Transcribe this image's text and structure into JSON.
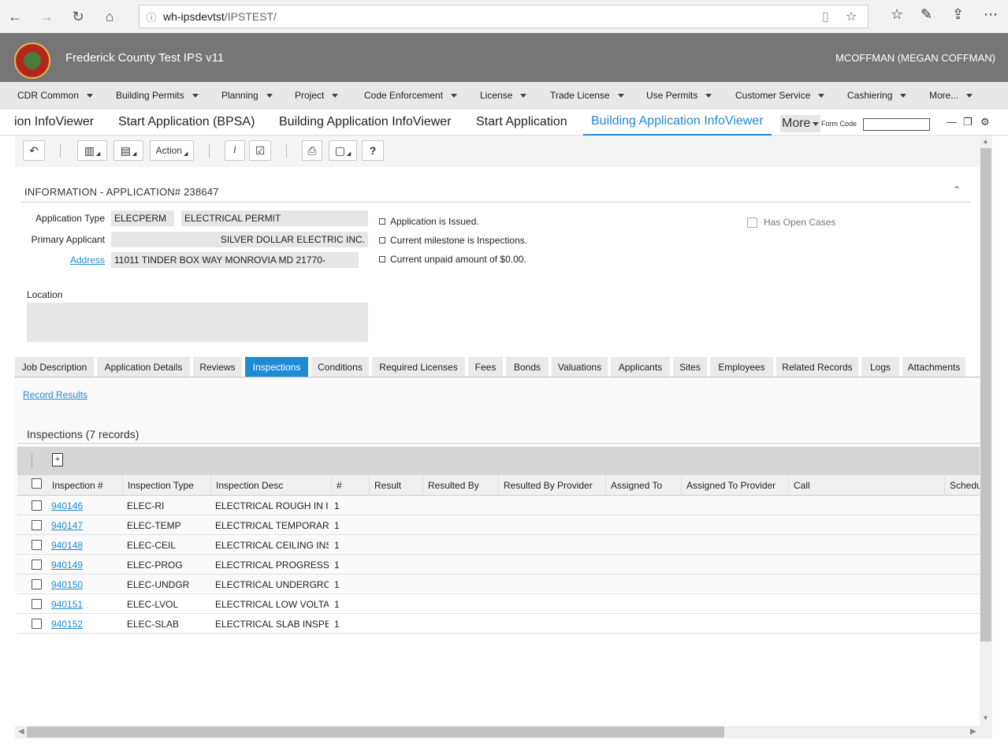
{
  "browser": {
    "back_icon": "back-arrow-icon",
    "url_host": "wh-ipsdevtst",
    "url_path": "/IPSTEST/"
  },
  "app": {
    "title": "Frederick County Test IPS v11",
    "user": "MCOFFMAN (MEGAN COFFMAN)"
  },
  "menu": [
    "CDR Common",
    "Building Permits",
    "Planning",
    "Project",
    "Code Enforcement",
    "License",
    "Trade License",
    "Use Permits",
    "Customer Service",
    "Cashiering",
    "More..."
  ],
  "workspace_tabs": [
    "ion InfoViewer",
    "Start Application (BPSA)",
    "Building Application InfoViewer",
    "Start Application",
    "Building Application InfoViewer"
  ],
  "workspace_more": "More",
  "form_code_label": "Form Code",
  "toolbar": {
    "action_label": "Action"
  },
  "section": {
    "title": "INFORMATION - APPLICATION# 238647"
  },
  "info": {
    "application_type_label": "Application Type",
    "application_type_code": "ELECPERM",
    "application_type_desc": "ELECTRICAL PERMIT",
    "primary_applicant_label": "Primary Applicant",
    "primary_applicant": "SILVER DOLLAR ELECTRIC INC.",
    "address_label": "Address",
    "address": "11011 TINDER BOX WAY MONROVIA MD 21770-",
    "location_label": "Location",
    "status_items": [
      "Application is Issued.",
      "Current milestone is Inspections.",
      "Current unpaid amount of $0.00."
    ],
    "has_open_cases_label": "Has Open Cases"
  },
  "detail_tabs": [
    "Job Description",
    "Application Details",
    "Reviews",
    "Inspections",
    "Conditions",
    "Required Licenses",
    "Fees",
    "Bonds",
    "Valuations",
    "Applicants",
    "Sites",
    "Employees",
    "Related Records",
    "Logs",
    "Attachments"
  ],
  "active_detail_tab": "Inspections",
  "inspections": {
    "record_results_link": "Record Results",
    "grid_title": "Inspections (7 records)",
    "columns": [
      "Inspection #",
      "Inspection Type",
      "Inspection Desc",
      "#",
      "Result",
      "Resulted By",
      "Resulted By Provider",
      "Assigned To",
      "Assigned To Provider",
      "Call",
      "Schedu"
    ],
    "rows": [
      {
        "number": "940146",
        "type": "ELEC-RI",
        "desc": "ELECTRICAL ROUGH IN I",
        "count": "1"
      },
      {
        "number": "940147",
        "type": "ELEC-TEMP",
        "desc": "ELECTRICAL TEMPORAR",
        "count": "1"
      },
      {
        "number": "940148",
        "type": "ELEC-CEIL",
        "desc": "ELECTRICAL CEILING INS",
        "count": "1"
      },
      {
        "number": "940149",
        "type": "ELEC-PROG",
        "desc": "ELECTRICAL PROGRESS",
        "count": "1"
      },
      {
        "number": "940150",
        "type": "ELEC-UNDGR",
        "desc": "ELECTRICAL UNDERGRC",
        "count": "1"
      },
      {
        "number": "940151",
        "type": "ELEC-LVOL",
        "desc": "ELECTRICAL LOW VOLTA",
        "count": "1"
      },
      {
        "number": "940152",
        "type": "ELEC-SLAB",
        "desc": "ELECTRICAL SLAB INSPE",
        "count": "1"
      }
    ]
  },
  "colors": {
    "accent": "#1e8bd6",
    "header_bg": "#767676",
    "menu_bg": "#e8e8e8"
  }
}
